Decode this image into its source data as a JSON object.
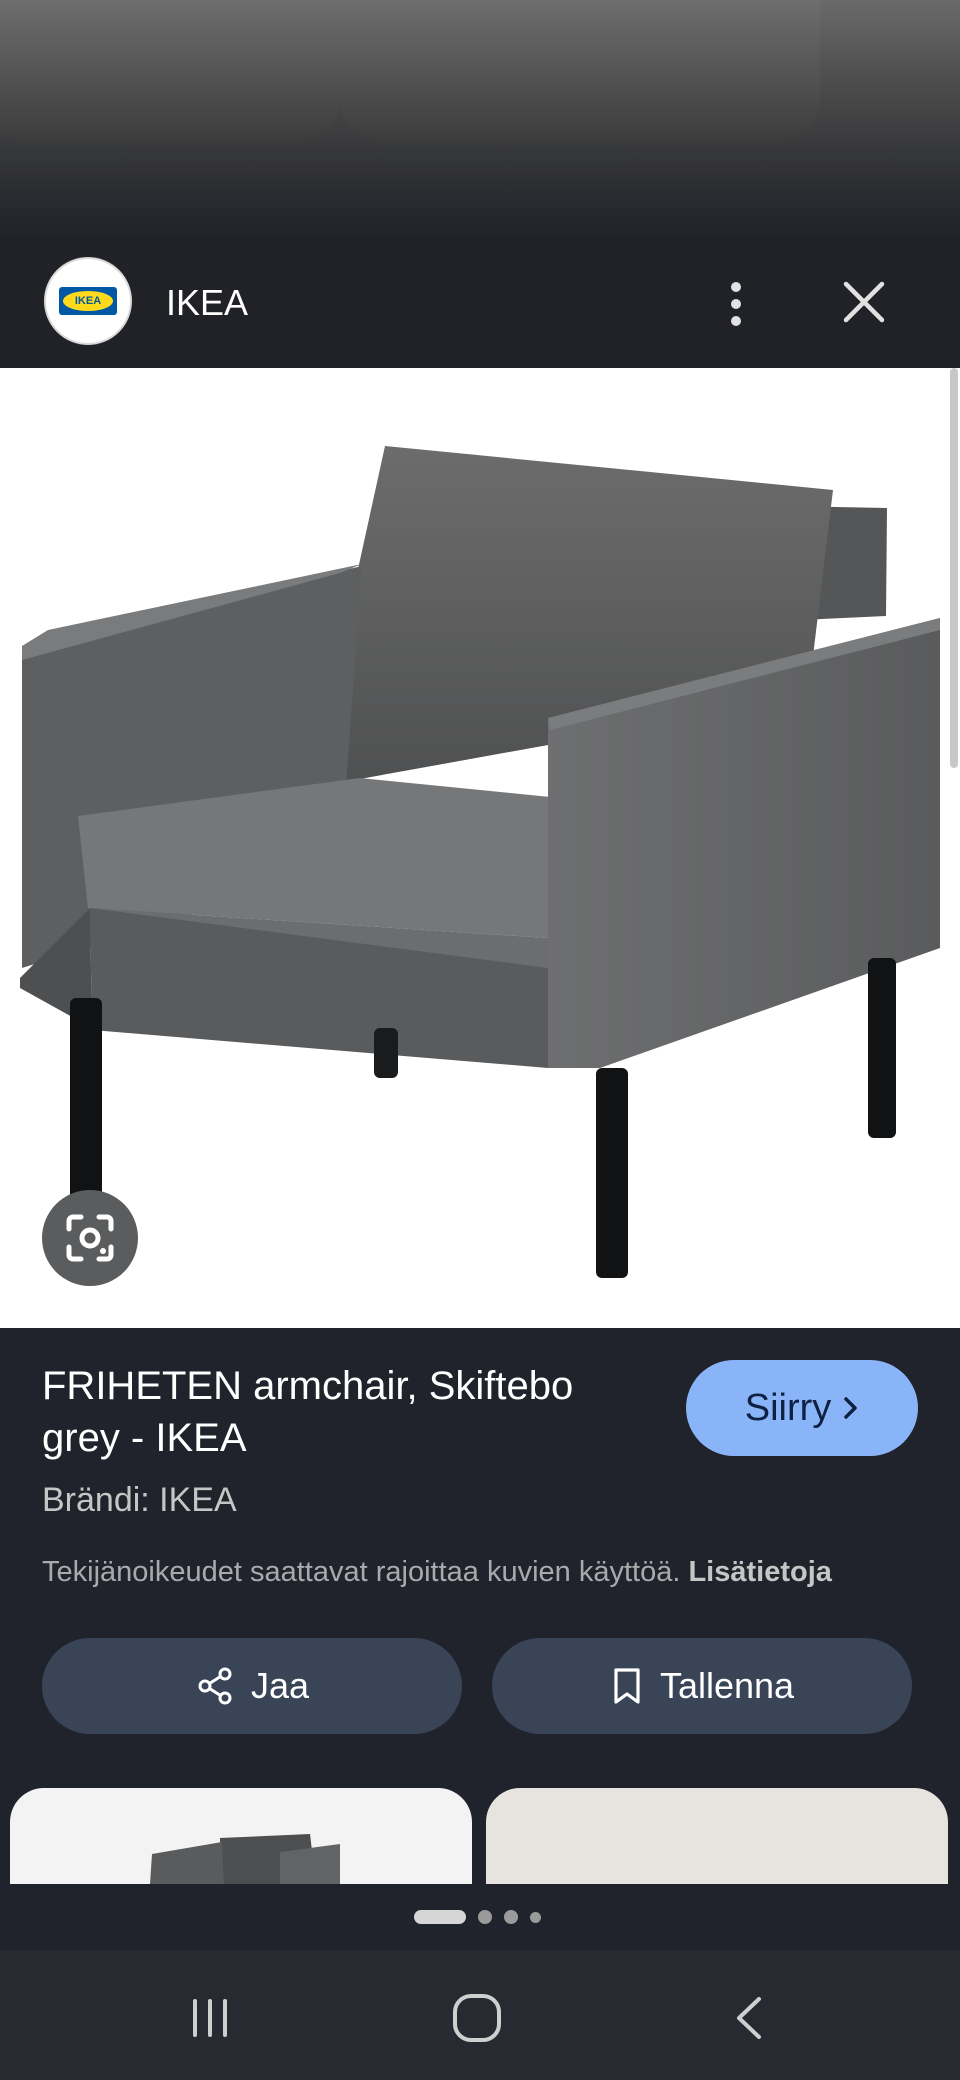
{
  "header": {
    "site_name": "IKEA",
    "logo_text": "IKEA"
  },
  "product": {
    "title": "FRIHETEN armchair, Skiftebo grey - IKEA",
    "brand": "Brändi: IKEA",
    "copyright_notice": "Tekijänoikeudet saattavat rajoittaa kuvien käyttöä.",
    "learn_more": "Lisätietoja"
  },
  "buttons": {
    "visit": "Siirry",
    "share": "Jaa",
    "save": "Tallenna"
  },
  "pager": {
    "pages": 4,
    "current": 1
  },
  "colors": {
    "background": "#20232b",
    "visit_button": "#8ab4f8",
    "action_button": "#394457",
    "chair": "#555657"
  },
  "icons": {
    "menu": "more-vert-icon",
    "close": "close-icon",
    "lens": "google-lens-icon",
    "share": "share-icon",
    "save": "bookmark-icon",
    "visit": "chevron-right-icon",
    "nav_recent": "recent-apps-icon",
    "nav_home": "home-icon",
    "nav_back": "back-icon"
  }
}
